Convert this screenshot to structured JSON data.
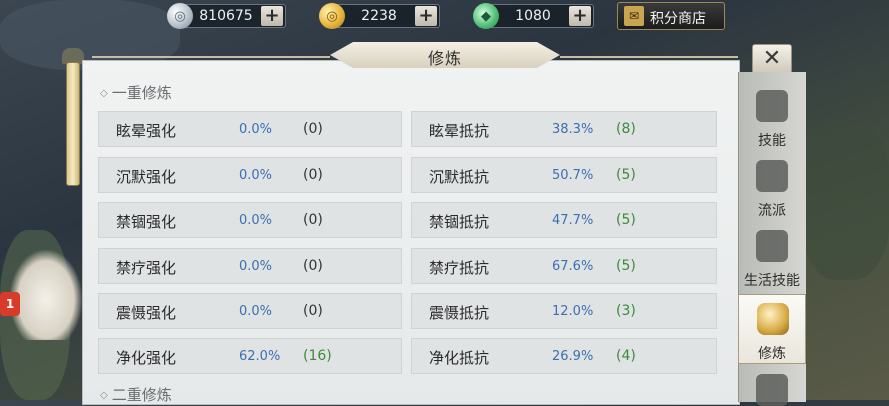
{
  "currencies": {
    "silver": {
      "value": "810675",
      "icon": "silver-coin-icon"
    },
    "gold": {
      "value": "2238",
      "icon": "gold-coin-icon"
    },
    "jade": {
      "value": "1080",
      "icon": "jade-ingot-icon"
    },
    "plus_label": "+"
  },
  "shop": {
    "label": "积分商店",
    "icon": "shop-icon"
  },
  "panel": {
    "title": "修炼",
    "close_label": "✕",
    "section1_title": "一重修炼",
    "section2_title": "二重修炼",
    "section_marker": "◇",
    "rows": [
      {
        "left": {
          "name": "眩晕强化",
          "pct": "0.0%",
          "count": "(0)"
        },
        "right": {
          "name": "眩晕抵抗",
          "pct": "38.3%",
          "count": "(8)"
        }
      },
      {
        "left": {
          "name": "沉默强化",
          "pct": "0.0%",
          "count": "(0)"
        },
        "right": {
          "name": "沉默抵抗",
          "pct": "50.7%",
          "count": "(5)"
        }
      },
      {
        "left": {
          "name": "禁锢强化",
          "pct": "0.0%",
          "count": "(0)"
        },
        "right": {
          "name": "禁锢抵抗",
          "pct": "47.7%",
          "count": "(5)"
        }
      },
      {
        "left": {
          "name": "禁疗强化",
          "pct": "0.0%",
          "count": "(0)"
        },
        "right": {
          "name": "禁疗抵抗",
          "pct": "67.6%",
          "count": "(5)"
        }
      },
      {
        "left": {
          "name": "震慑强化",
          "pct": "0.0%",
          "count": "(0)"
        },
        "right": {
          "name": "震慑抵抗",
          "pct": "12.0%",
          "count": "(3)"
        }
      },
      {
        "left": {
          "name": "净化强化",
          "pct": "62.0%",
          "count": "(16)"
        },
        "right": {
          "name": "净化抵抗",
          "pct": "26.9%",
          "count": "(4)"
        }
      }
    ]
  },
  "tabs": [
    {
      "label": "技能",
      "icon": "skill-book-icon",
      "active": false
    },
    {
      "label": "流派",
      "icon": "school-scroll-icon",
      "active": false
    },
    {
      "label": "生活技能",
      "icon": "cooking-pot-icon",
      "active": false
    },
    {
      "label": "修炼",
      "icon": "fist-icon",
      "active": true
    }
  ],
  "notification": {
    "count": "1"
  },
  "colors": {
    "percent_blue": "#3a6fb0",
    "count_green": "#3d8a3a",
    "panel_bg": "#eef0f1"
  }
}
